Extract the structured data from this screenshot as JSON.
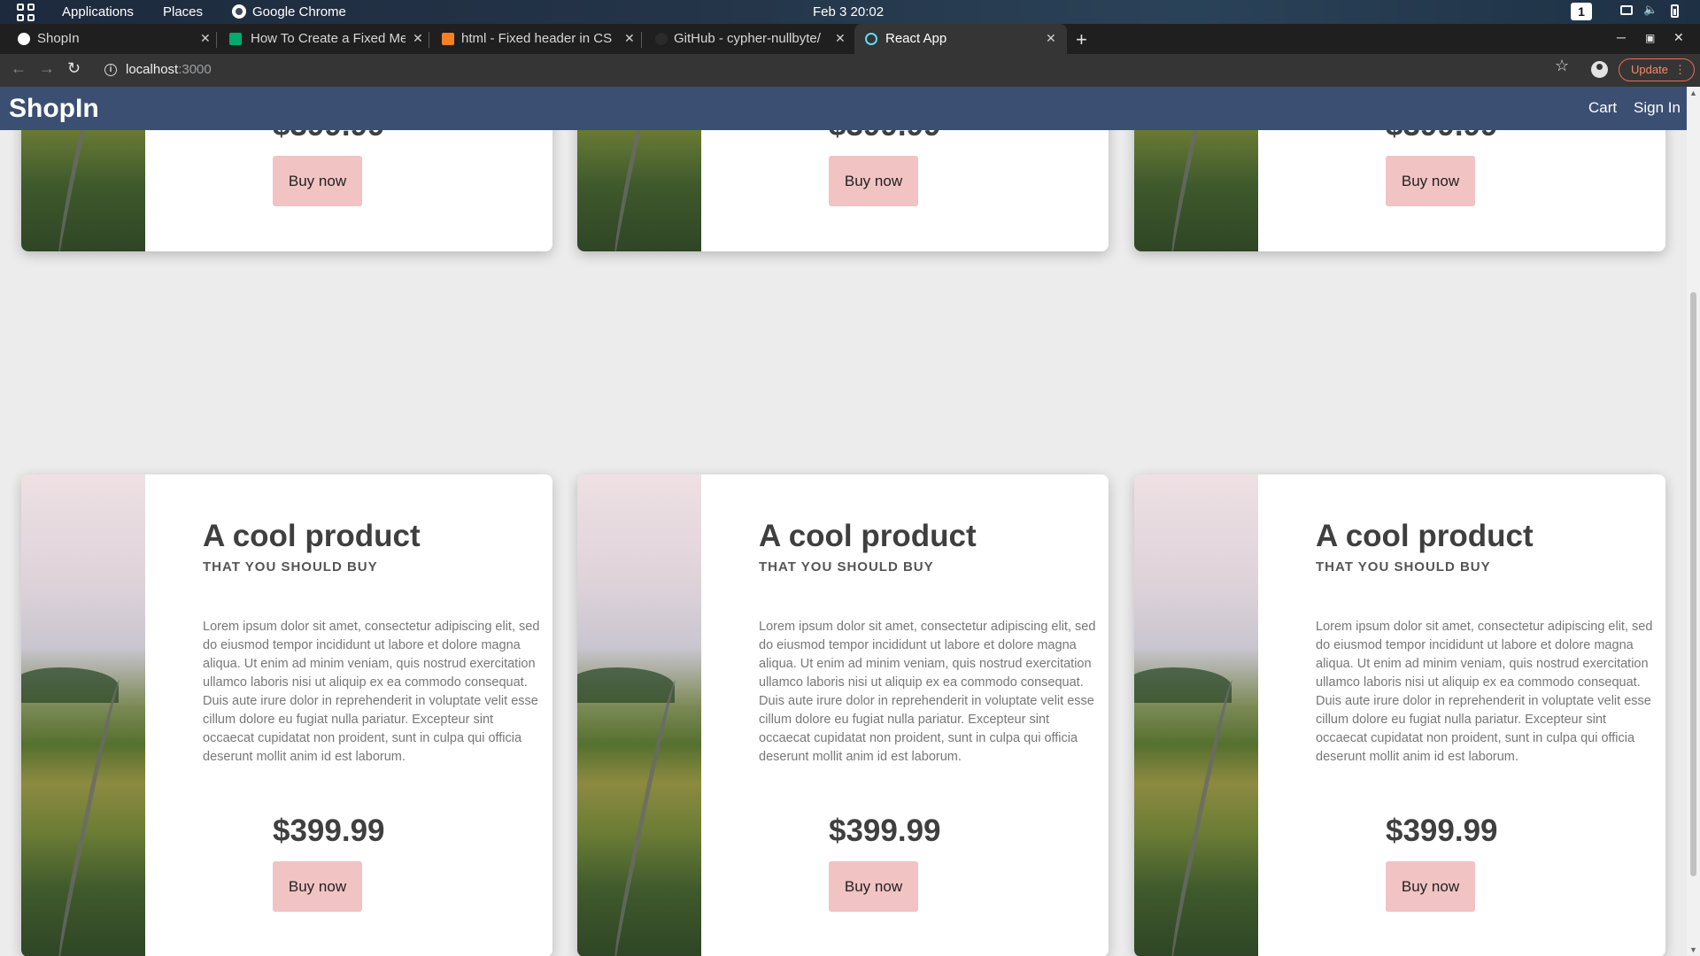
{
  "system_bar": {
    "applications": "Applications",
    "places": "Places",
    "browser_name": "Google Chrome",
    "clock": "Feb 3  20:02",
    "workspace": "1"
  },
  "tabs": [
    {
      "title": "ShopIn",
      "favicon_color": "#ffffff",
      "active": false
    },
    {
      "title": "How To Create a Fixed Me",
      "favicon_color": "#04aa6d",
      "active": false
    },
    {
      "title": "html - Fixed header in CS",
      "favicon_color": "#f48024",
      "active": false
    },
    {
      "title": "GitHub - cypher-nullbyte/",
      "favicon_color": "#2b2b2b",
      "active": false
    },
    {
      "title": "React App",
      "favicon_color": "#61dafb",
      "active": true
    }
  ],
  "address_bar": {
    "host": "localhost",
    "port": ":3000",
    "update_label": "Update"
  },
  "app": {
    "brand": "ShopIn",
    "nav": {
      "cart": "Cart",
      "sign_in": "Sign In"
    },
    "accent_color": "#3b4f72",
    "button_color": "#f1c3c3"
  },
  "products": [
    {
      "title": "A cool product",
      "subtitle": "THAT YOU SHOULD BUY",
      "description": "Lorem ipsum dolor sit amet, consectetur adipiscing elit, sed do eiusmod tempor incididunt ut labore et dolore magna aliqua. Ut enim ad minim veniam, quis nostrud exercitation ullamco laboris nisi ut aliquip ex ea commodo consequat. Duis aute irure dolor in reprehenderit in voluptate velit esse cillum dolore eu fugiat nulla pariatur. Excepteur sint occaecat cupidatat non proident, sunt in culpa qui officia deserunt mollit anim id est laborum.",
      "price": "$399.99",
      "buy_label": "Buy now"
    }
  ]
}
